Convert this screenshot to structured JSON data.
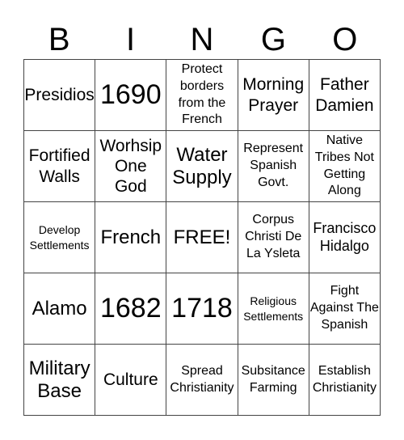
{
  "header": {
    "letters": [
      "B",
      "I",
      "N",
      "G",
      "O"
    ]
  },
  "cells": [
    [
      "Presidios",
      "1690",
      "Protect borders from the French",
      "Morning Prayer",
      "Father Damien"
    ],
    [
      "Fortified Walls",
      "Worhsip One God",
      "Water Supply",
      "Represent Spanish Govt.",
      "Native Tribes Not Getting Along"
    ],
    [
      "Develop Settlements",
      "French",
      "FREE!",
      "Corpus Christi De La Ysleta",
      "Francisco Hidalgo"
    ],
    [
      "Alamo",
      "1682",
      "1718",
      "Religious Settlements",
      "Fight Against The Spanish"
    ],
    [
      "Military Base",
      "Culture",
      "Spread Christianity",
      "Subsitance Farming",
      "Establish Christianity"
    ]
  ]
}
